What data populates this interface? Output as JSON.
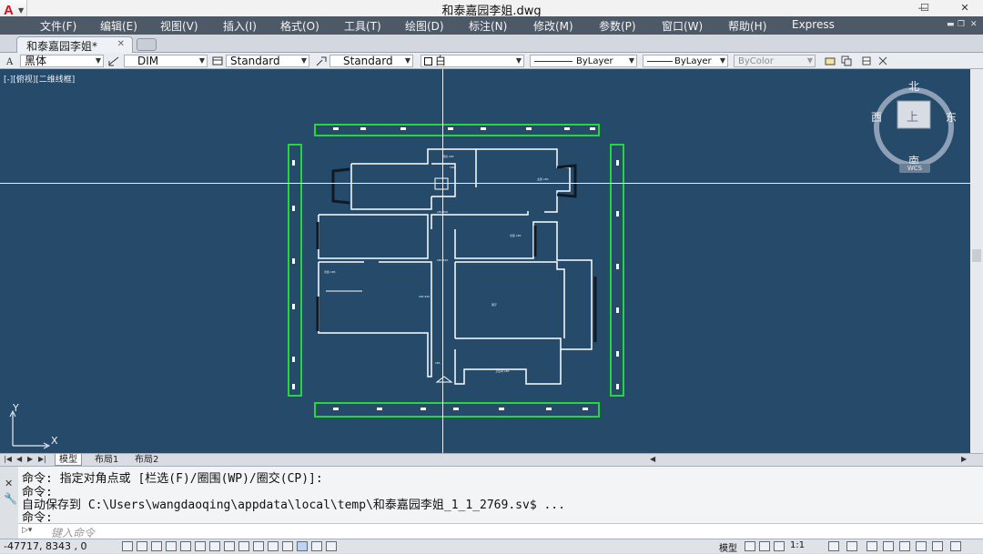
{
  "window": {
    "title": "和泰嘉园李姐.dwg",
    "minimize": "—",
    "maximize": "☐",
    "close": "✕",
    "app_logo": "A"
  },
  "menu": [
    "文件(F)",
    "编辑(E)",
    "视图(V)",
    "插入(I)",
    "格式(O)",
    "工具(T)",
    "绘图(D)",
    "标注(N)",
    "修改(M)",
    "参数(P)",
    "窗口(W)",
    "帮助(H)",
    "Express"
  ],
  "doc_tab": {
    "label": "和泰嘉园李姐*",
    "close": "✕"
  },
  "properties_toolbar": {
    "text_style": "黑体",
    "dim_style": "DIM",
    "table_style": "Standard",
    "multileader_style": "Standard",
    "color": "白",
    "linetype": "ByLayer",
    "lineweight": "ByLayer",
    "plot_style": "ByColor"
  },
  "viewport": {
    "label": "[-][俯视][二维线框]"
  },
  "viewcube": {
    "north": "北",
    "south": "南",
    "west": "西",
    "east": "东",
    "face": "上",
    "wcs": "WCS"
  },
  "ucs": {
    "x": "X",
    "y": "Y"
  },
  "layout_tabs": {
    "model": "模型",
    "layout1": "布局1",
    "layout2": "布局2"
  },
  "command": {
    "history": [
      "命令: 指定对角点或 [栏选(F)/圈围(WP)/圈交(CP)]:",
      "命令:",
      "自动保存到 C:\\Users\\wangdaoqing\\appdata\\local\\temp\\和泰嘉园李姐_1_1_2769.sv$ ...",
      "命令:"
    ],
    "placeholder": "键入命令"
  },
  "status": {
    "coordinates": "-47717, 8343 , 0",
    "model_label": "模型",
    "annotation_scale": "1:1"
  },
  "colors": {
    "canvas": "#254a6a",
    "menubar": "#4e5967",
    "dimension": "#22d83a",
    "wall": "#ffffff"
  }
}
